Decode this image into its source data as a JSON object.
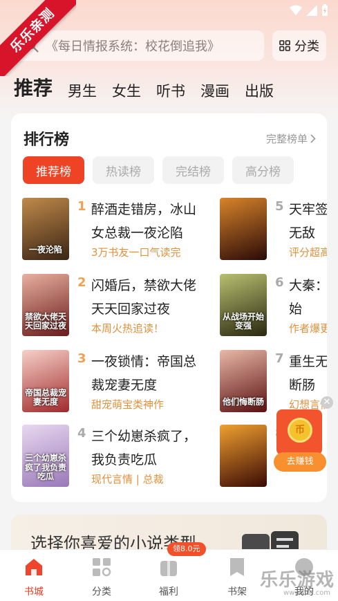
{
  "ribbon": {
    "text": "乐乐亲测"
  },
  "search": {
    "placeholder": "《每日情报系统：校花倒追我》",
    "icon": "search-icon"
  },
  "category_button": {
    "label": "分类",
    "icon": "grid-icon"
  },
  "channel_tabs": [
    {
      "label": "推荐",
      "active": true
    },
    {
      "label": "男生"
    },
    {
      "label": "女生"
    },
    {
      "label": "听书"
    },
    {
      "label": "漫画"
    },
    {
      "label": "出版"
    }
  ],
  "ranking": {
    "title": "排行榜",
    "more_label": "完整榜单",
    "tabs": [
      {
        "label": "推荐榜",
        "active": true
      },
      {
        "label": "热读榜"
      },
      {
        "label": "完结榜"
      },
      {
        "label": "高分榜"
      }
    ],
    "books": [
      {
        "rank": "1",
        "title": "醉酒走错房，冰山女总裁一夜沦陷",
        "tag": "3万书友一口气读完",
        "cover_text": "一夜沦陷",
        "cover_color": "#6b4a2c"
      },
      {
        "rank": "2",
        "title": "闪婚后，禁欲大佬天天回家过夜",
        "tag": "本周火热追读！",
        "cover_text": "禁欲大佬天天回家过夜",
        "cover_color": "#7a2a2a"
      },
      {
        "rank": "3",
        "title": "一夜锁情：帝国总裁宠妻无度",
        "tag": "甜宠萌宝类神作",
        "cover_text": "帝国总裁宠妻无度",
        "cover_color": "#a8383a"
      },
      {
        "rank": "4",
        "title": "三个幼崽杀疯了，我负责吃瓜",
        "tag": "现代言情 | 总裁",
        "cover_text": "三个幼崽杀疯了我负责吃瓜",
        "cover_color": "#c9a6c8"
      },
      {
        "rank": "5",
        "title": "天牢签到，我举世无敌",
        "tag": "评分超高",
        "cover_text": "",
        "cover_color": "#3a1410"
      },
      {
        "rank": "6",
        "title": "大秦：开局属性开始",
        "tag": "作者爆更",
        "cover_text": "从战场开始变强",
        "cover_color": "#556030"
      },
      {
        "rank": "7",
        "title": "重生无敌，他们悔断肠",
        "tag": "幻想言情",
        "cover_text": "他们悔断肠",
        "cover_color": "#6a2020"
      },
      {
        "rank": "8",
        "title": "",
        "tag": "",
        "cover_text": "",
        "cover_color": "#5a1a0a"
      }
    ]
  },
  "reward": {
    "label": "去赚钱",
    "coin_text": "币"
  },
  "genre_card": {
    "text": "选择你喜爱的小说类型"
  },
  "bottom_nav": [
    {
      "label": "书城",
      "icon": "home-icon",
      "active": true
    },
    {
      "label": "分类",
      "icon": "category-icon"
    },
    {
      "label": "福利",
      "icon": "gift-icon"
    },
    {
      "label": "书架",
      "icon": "bookshelf-icon"
    },
    {
      "label": "我的",
      "icon": "profile-icon"
    }
  ],
  "welfare_badge": "领8.0元",
  "watermark": {
    "text": "乐乐游戏",
    "url": "www.66t.com"
  },
  "colors": {
    "accent": "#ee4325",
    "tag": "#e0913e",
    "rank_gold": "#f0a050"
  }
}
